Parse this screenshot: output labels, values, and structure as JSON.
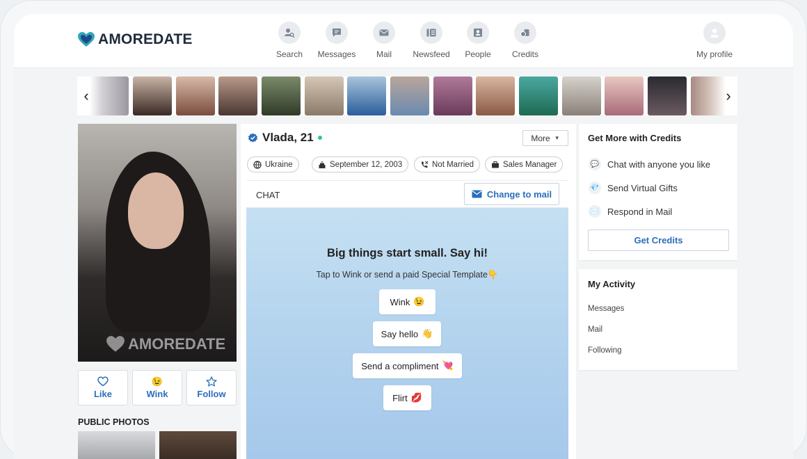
{
  "header": {
    "brand": "AMOREDATE",
    "nav": [
      {
        "label": "Search",
        "icon": "search-person-icon"
      },
      {
        "label": "Messages",
        "icon": "chat-bubble-icon"
      },
      {
        "label": "Mail",
        "icon": "envelope-icon"
      },
      {
        "label": "Newsfeed",
        "icon": "newsfeed-icon"
      },
      {
        "label": "People",
        "icon": "people-card-icon"
      },
      {
        "label": "Credits",
        "icon": "coins-icon"
      }
    ],
    "profile_label": "My profile"
  },
  "carousel": {
    "prev_icon": "chevron-left-icon",
    "next_icon": "chevron-right-icon",
    "count": 15
  },
  "profile": {
    "name": "Vlada, 21",
    "verified": true,
    "online": true,
    "more_label": "More",
    "watermark": "AMOREDATE",
    "tags": [
      {
        "icon": "globe-icon",
        "text": "Ukraine"
      },
      {
        "icon": "cake-icon",
        "text": "September 12, 2003"
      },
      {
        "icon": "phone-icon",
        "text": "Not Married"
      },
      {
        "icon": "briefcase-icon",
        "text": "Sales Manager"
      }
    ],
    "actions": [
      {
        "label": "Like",
        "icon": "heart-icon"
      },
      {
        "label": "Wink",
        "icon": "wink-emoji-icon"
      },
      {
        "label": "Follow",
        "icon": "star-icon"
      }
    ],
    "public_photos_title": "PUBLIC PHOTOS"
  },
  "chat": {
    "label": "CHAT",
    "change_mail_label": "Change to mail",
    "headline": "Big things start small. Say hi!",
    "subline": "Tap to Wink or send a paid Special Template👇",
    "templates": [
      {
        "text": "Wink",
        "emoji": "😉"
      },
      {
        "text": "Say hello",
        "emoji": "👋"
      },
      {
        "text": "Send a compliment",
        "emoji": "💘"
      },
      {
        "text": "Flirt",
        "emoji": "💋"
      }
    ]
  },
  "credits_card": {
    "title": "Get More with Credits",
    "features": [
      {
        "icon": "speech-bubble-icon",
        "text": "Chat with anyone you like"
      },
      {
        "icon": "diamond-icon",
        "text": "Send Virtual Gifts"
      },
      {
        "icon": "envelope-icon",
        "text": "Respond in Mail"
      }
    ],
    "button_label": "Get Credits"
  },
  "activity_card": {
    "title": "My Activity",
    "items": [
      "Messages",
      "Mail",
      "Following"
    ]
  },
  "colors": {
    "accent": "#2a6ebd",
    "online": "#3cc47c",
    "chat_bg": "#b3d3ee",
    "brand_heart": "#2fa8b8"
  }
}
